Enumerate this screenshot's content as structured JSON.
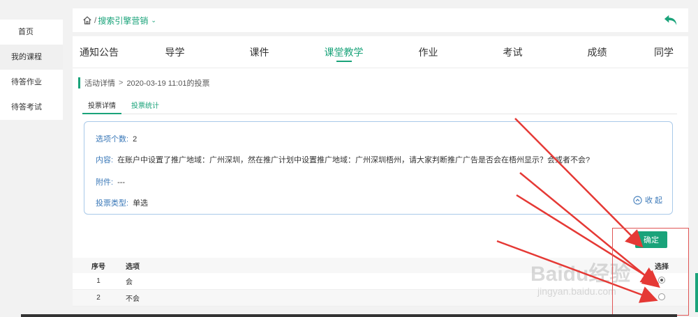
{
  "sidebar": {
    "items": [
      {
        "label": "首页"
      },
      {
        "label": "我的课程"
      },
      {
        "label": "待答作业"
      },
      {
        "label": "待答考试"
      }
    ]
  },
  "breadcrumb": {
    "separator": "/",
    "course": "搜索引擎营销"
  },
  "tabs": [
    {
      "label": "通知公告"
    },
    {
      "label": "导学"
    },
    {
      "label": "课件"
    },
    {
      "label": "课堂教学"
    },
    {
      "label": "作业"
    },
    {
      "label": "考试"
    },
    {
      "label": "成绩"
    },
    {
      "label": "同学"
    }
  ],
  "activity": {
    "crumb_label": "活动详情",
    "crumb_sep": ">",
    "title": "2020-03-19 11:01的投票"
  },
  "subtabs": [
    {
      "label": "投票详情"
    },
    {
      "label": "投票统计"
    }
  ],
  "detail": {
    "count_label": "选项个数:",
    "count_value": "2",
    "content_label": "内容:",
    "content_value": "在账户中设置了推广地域：广州深圳，然在推广计划中设置推广地域：广州深圳梧州，请大家判断推广广告是否会在梧州显示？会或者不会?",
    "attach_label": "附件:",
    "attach_value": "---",
    "type_label": "投票类型:",
    "type_value": "单选",
    "collapse_label": "收 起"
  },
  "confirm_label": "确定",
  "table": {
    "headers": {
      "no": "序号",
      "option": "选项",
      "select": "选择"
    },
    "rows": [
      {
        "no": "1",
        "option": "会",
        "selected": true
      },
      {
        "no": "2",
        "option": "不会",
        "selected": false
      }
    ]
  },
  "watermark": {
    "logo": "Baidu经验",
    "url": "jingyan.baidu.com"
  },
  "colors": {
    "accent": "#1aa37a",
    "link": "#3a78b8",
    "annotation": "#e53935"
  }
}
